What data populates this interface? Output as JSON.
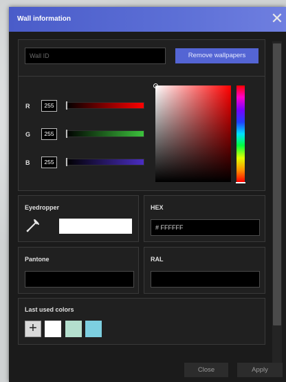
{
  "dialog": {
    "title": "Wall information",
    "close_symbol": "✕"
  },
  "wall": {
    "id_placeholder": "Wall ID",
    "remove_button": "Remove wallpapers"
  },
  "rgb": {
    "r_label": "R",
    "r_value": "255",
    "g_label": "G",
    "g_value": "255",
    "b_label": "B",
    "b_value": "255"
  },
  "eyedropper": {
    "label": "Eyedropper",
    "icon": "eyedropper-icon",
    "preview_color": "#FFFFFF"
  },
  "hex": {
    "label": "HEX",
    "value": "# FFFFFF"
  },
  "pantone": {
    "label": "Pantone",
    "value": ""
  },
  "ral": {
    "label": "RAL",
    "value": ""
  },
  "last_used": {
    "label": "Last used colors",
    "add_symbol": "+",
    "swatches": [
      "#FFFFFF",
      "#B4DFCE",
      "#7DCFE0"
    ]
  },
  "footer": {
    "close": "Close",
    "apply": "Apply"
  },
  "colors": {
    "accent": "#5465D4",
    "title_gradient_start": "#4A5CC9"
  }
}
